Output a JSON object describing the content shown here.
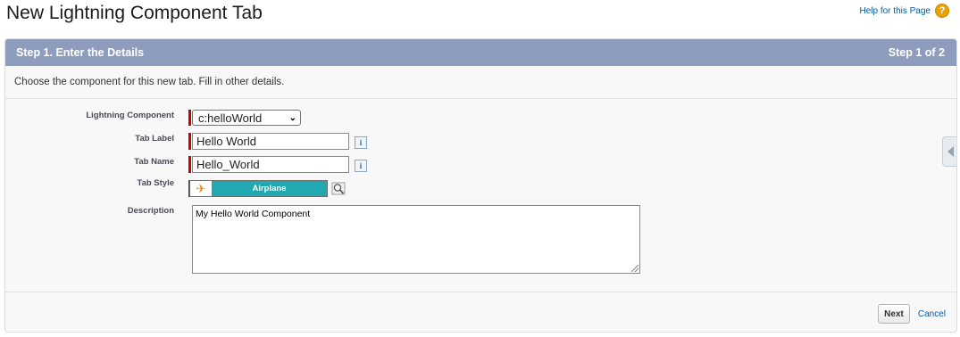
{
  "page": {
    "title": "New Lightning Component Tab",
    "help_label": "Help for this Page",
    "help_icon": "help-icon"
  },
  "step": {
    "title": "Step 1. Enter the Details",
    "progress": "Step 1 of 2"
  },
  "instructions": "Choose the component for this new tab. Fill in other details.",
  "form": {
    "lightning_component": {
      "label": "Lightning Component",
      "value": "c:helloWorld",
      "required": true
    },
    "tab_label": {
      "label": "Tab Label",
      "value": "Hello World",
      "required": true
    },
    "tab_name": {
      "label": "Tab Name",
      "value": "Hello_World",
      "required": true
    },
    "tab_style": {
      "label": "Tab Style",
      "value": "Airplane",
      "icon": "airplane-icon",
      "color": "#22a8b0",
      "required": true
    },
    "description": {
      "label": "Description",
      "value": "My Hello World Component"
    }
  },
  "footer": {
    "next_label": "Next",
    "cancel_label": "Cancel"
  },
  "colors": {
    "header_bg": "#8e9dbe",
    "required": "#cc0000",
    "link": "#015ba7"
  }
}
